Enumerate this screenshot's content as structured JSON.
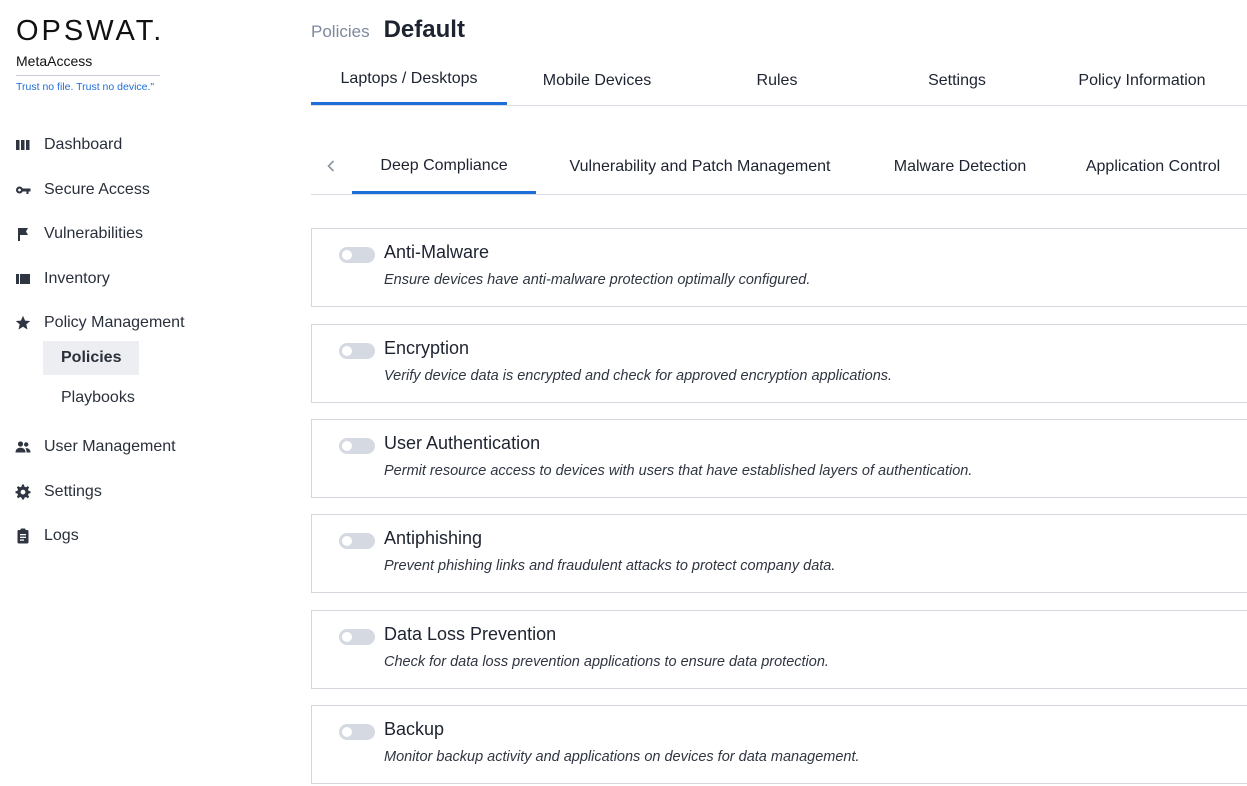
{
  "brand": {
    "logo": "OPSWAT.",
    "product": "MetaAccess",
    "tagline": "Trust no file. Trust no device.\""
  },
  "sidebar": {
    "items": [
      {
        "label": "Dashboard",
        "icon": "dashboard-icon"
      },
      {
        "label": "Secure Access",
        "icon": "key-icon"
      },
      {
        "label": "Vulnerabilities",
        "icon": "flag-icon"
      },
      {
        "label": "Inventory",
        "icon": "inventory-icon"
      },
      {
        "label": "Policy Management",
        "icon": "star-icon"
      },
      {
        "label": "User Management",
        "icon": "users-icon"
      },
      {
        "label": "Settings",
        "icon": "gear-icon"
      },
      {
        "label": "Logs",
        "icon": "clipboard-icon"
      }
    ],
    "subitems": [
      {
        "label": "Policies",
        "active": true
      },
      {
        "label": "Playbooks",
        "active": false
      }
    ]
  },
  "header": {
    "breadcrumb": "Policies",
    "title": "Default"
  },
  "tabs_primary": [
    {
      "label": "Laptops / Desktops",
      "active": true
    },
    {
      "label": "Mobile Devices",
      "active": false
    },
    {
      "label": "Rules",
      "active": false
    },
    {
      "label": "Settings",
      "active": false
    },
    {
      "label": "Policy Information",
      "active": false
    }
  ],
  "tabs_secondary": [
    {
      "label": "Deep Compliance",
      "active": true
    },
    {
      "label": "Vulnerability and Patch Management",
      "active": false
    },
    {
      "label": "Malware Detection",
      "active": false
    },
    {
      "label": "Application Control",
      "active": false
    }
  ],
  "cards": [
    {
      "title": "Anti-Malware",
      "description": "Ensure devices have anti-malware protection optimally configured.",
      "enabled": false
    },
    {
      "title": "Encryption",
      "description": "Verify device data is encrypted and check for approved encryption applications.",
      "enabled": false
    },
    {
      "title": "User Authentication",
      "description": "Permit resource access to devices with users that have established layers of authentication.",
      "enabled": false
    },
    {
      "title": "Antiphishing",
      "description": "Prevent phishing links and fraudulent attacks to protect company data.",
      "enabled": false
    },
    {
      "title": "Data Loss Prevention",
      "description": "Check for data loss prevention applications to ensure data protection.",
      "enabled": false
    },
    {
      "title": "Backup",
      "description": "Monitor backup activity and applications on devices for data management.",
      "enabled": false
    }
  ],
  "colors": {
    "accent": "#1d6ed8",
    "toggle_off": "#d4d9e2",
    "active_sub_bg": "#edeef1"
  }
}
